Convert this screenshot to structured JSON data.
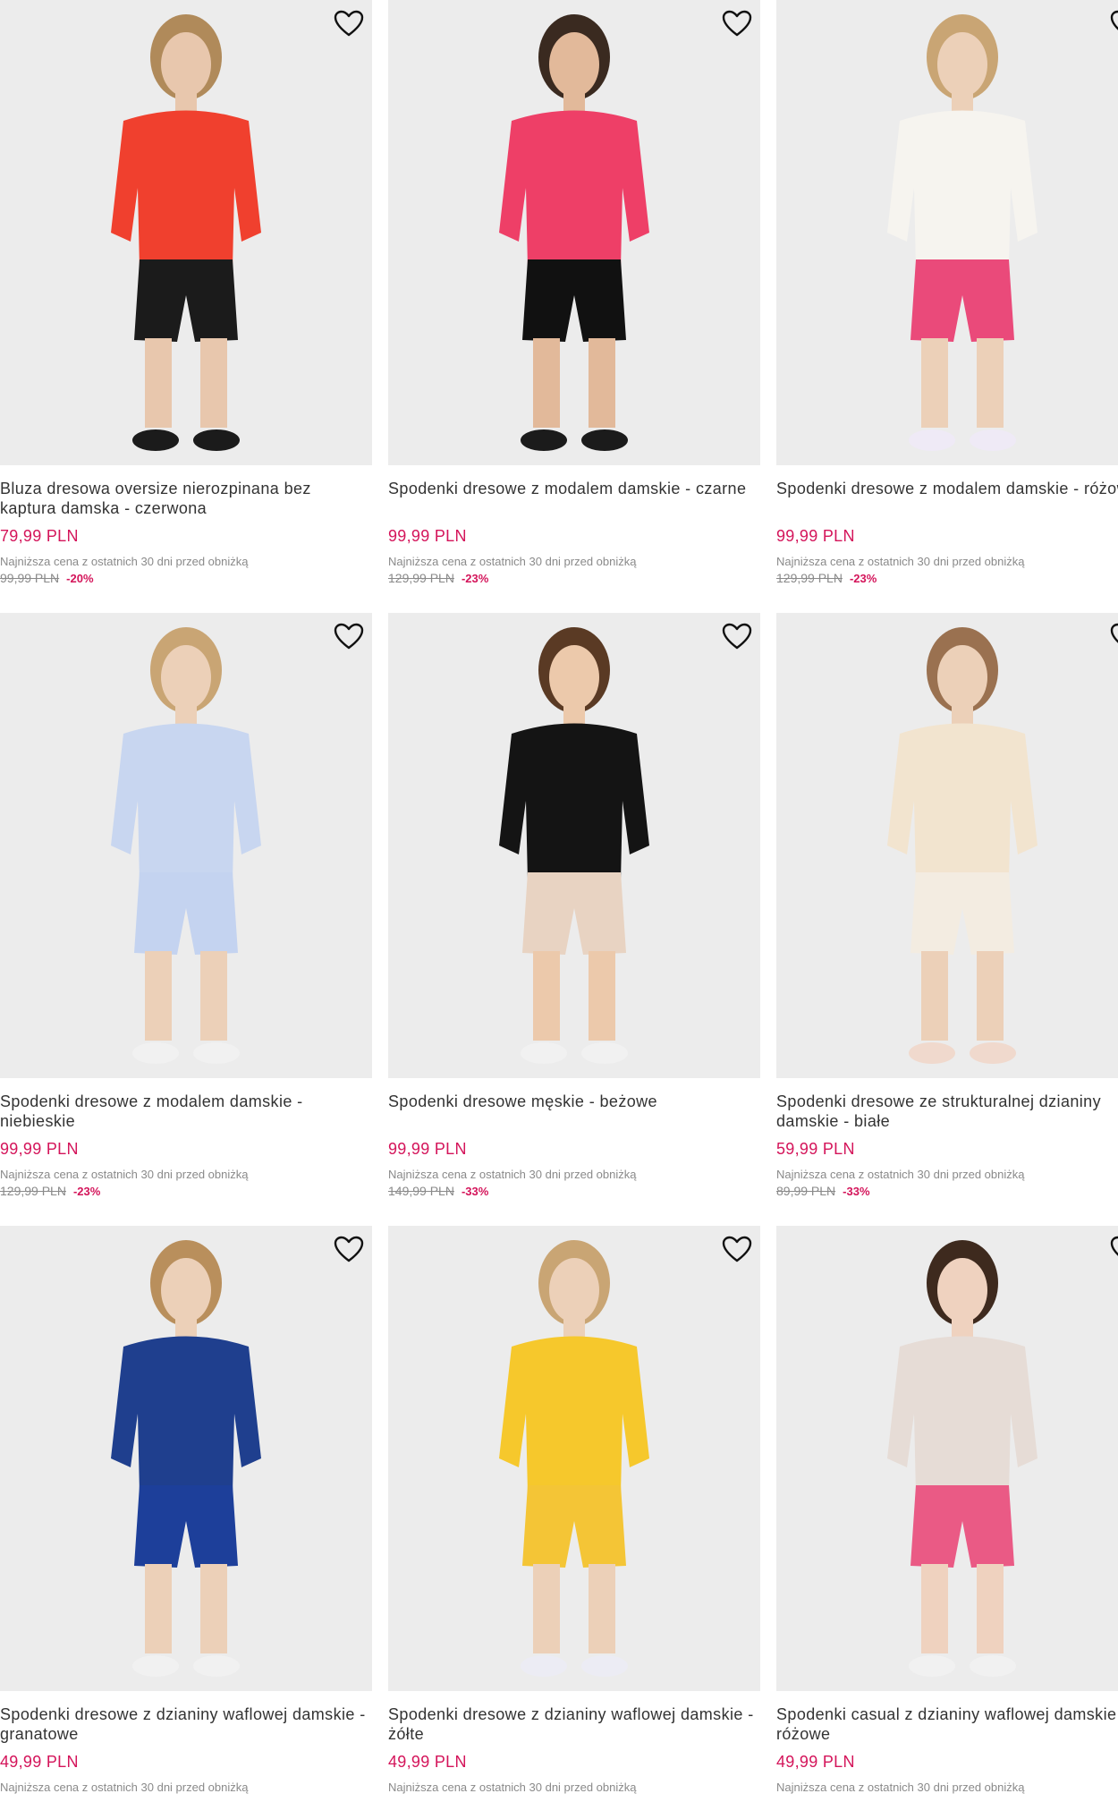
{
  "products": [
    {
      "title": "Bluza dresowa oversize nierozpinana bez kaptura damska - czerwona",
      "price": "79,99 PLN",
      "lowest_label": "Najniższa cena z ostatnich 30 dni przed obniżką",
      "old_price": "99,99 PLN",
      "discount": "-20%",
      "colors": {
        "top": "#f0402e",
        "bottom": "#1b1b1b",
        "hair": "#b08a5a",
        "skin": "#e8c7ad",
        "shoes": "#1b1b1b"
      }
    },
    {
      "title": "Spodenki dresowe z modalem damskie - czarne",
      "price": "99,99 PLN",
      "lowest_label": "Najniższa cena z ostatnich 30 dni przed obniżką",
      "old_price": "129,99 PLN",
      "discount": "-23%",
      "colors": {
        "top": "#ee3f67",
        "bottom": "#111111",
        "hair": "#3a2a20",
        "skin": "#e2b99a",
        "shoes": "#1b1b1b"
      }
    },
    {
      "title": "Spodenki dresowe z modalem damskie - różowe",
      "price": "99,99 PLN",
      "lowest_label": "Najniższa cena z ostatnich 30 dni przed obniżką",
      "old_price": "129,99 PLN",
      "discount": "-23%",
      "colors": {
        "top": "#f6f4ef",
        "bottom": "#ea4a7a",
        "hair": "#c9a574",
        "skin": "#ecd0b8",
        "shoes": "#efeaf6"
      }
    },
    {
      "title": "Spodenki dresowe z modalem damskie - niebieskie",
      "price": "99,99 PLN",
      "lowest_label": "Najniższa cena z ostatnich 30 dni przed obniżką",
      "old_price": "129,99 PLN",
      "discount": "-23%",
      "colors": {
        "top": "#c8d6f0",
        "bottom": "#c4d3f0",
        "hair": "#c9a574",
        "skin": "#ecd0b8",
        "shoes": "#f1f1f1"
      }
    },
    {
      "title": "Spodenki dresowe męskie - beżowe",
      "price": "99,99 PLN",
      "lowest_label": "Najniższa cena z ostatnich 30 dni przed obniżką",
      "old_price": "149,99 PLN",
      "discount": "-33%",
      "colors": {
        "top": "#141414",
        "bottom": "#e8d3c2",
        "hair": "#5a3a24",
        "skin": "#ecc9ab",
        "shoes": "#f1f1f1"
      }
    },
    {
      "title": "Spodenki dresowe ze strukturalnej dzianiny damskie - białe",
      "price": "59,99 PLN",
      "lowest_label": "Najniższa cena z ostatnich 30 dni przed obniżką",
      "old_price": "89,99 PLN",
      "discount": "-33%",
      "colors": {
        "top": "#f2e4cf",
        "bottom": "#f3ece1",
        "hair": "#9a7150",
        "skin": "#ecd0b8",
        "shoes": "#f0d9cd"
      }
    },
    {
      "title": "Spodenki dresowe z dzianiny waflowej damskie - granatowe",
      "price": "49,99 PLN",
      "lowest_label": "Najniższa cena z ostatnich 30 dni przed obniżką",
      "colors": {
        "top": "#1f3f8e",
        "bottom": "#1d3f9a",
        "hair": "#b98f5c",
        "skin": "#ecd0b8",
        "shoes": "#f1f1f1"
      }
    },
    {
      "title": "Spodenki dresowe z dzianiny waflowej damskie - żółte",
      "price": "49,99 PLN",
      "lowest_label": "Najniższa cena z ostatnich 30 dni przed obniżką",
      "colors": {
        "top": "#f6c82c",
        "bottom": "#f4c536",
        "hair": "#c9a574",
        "skin": "#ecd0b8",
        "shoes": "#ececf4"
      }
    },
    {
      "title": "Spodenki casual z dzianiny waflowej damskie - różowe",
      "price": "49,99 PLN",
      "lowest_label": "Najniższa cena z ostatnich 30 dni przed obniżką",
      "colors": {
        "top": "#e6dcd6",
        "bottom": "#ea5a85",
        "hair": "#3e2a1e",
        "skin": "#efd2bf",
        "shoes": "#f1f1f1"
      }
    }
  ]
}
